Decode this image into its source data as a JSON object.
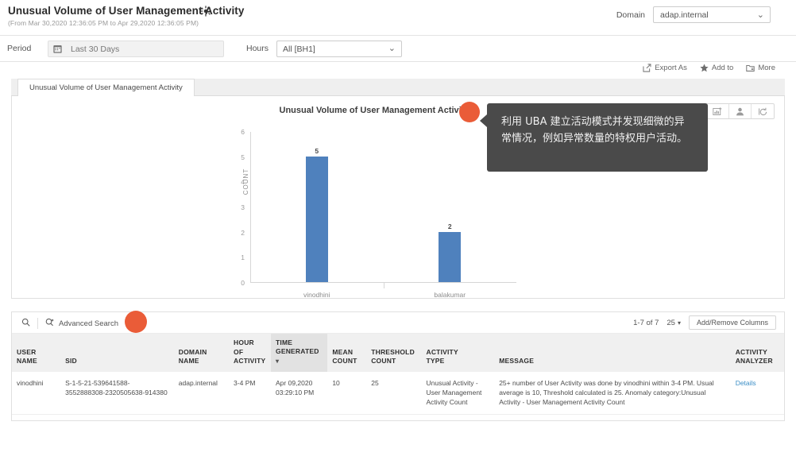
{
  "header": {
    "title": "Unusual Volume of User Management Activity",
    "sparkle_icon": "sparkle-icon",
    "subtitle": "(From Mar 30,2020 12:36:05 PM to Apr 29,2020 12:36:05 PM)",
    "domain_label": "Domain",
    "domain_value": "adap.internal"
  },
  "filters": {
    "period_label": "Period",
    "period_value": "Last 30 Days",
    "calendar_icon": "calendar-icon",
    "hours_label": "Hours",
    "hours_value": "All [BH1]"
  },
  "actions": [
    {
      "label": "Export As",
      "icon": "export-icon"
    },
    {
      "label": "Add to",
      "icon": "star-icon"
    },
    {
      "label": "More",
      "icon": "more-folder-icon"
    }
  ],
  "tab": {
    "label": "Unusual Volume of User Management Activity"
  },
  "chart_tools": [
    {
      "name": "add-chart-icon"
    },
    {
      "name": "user-icon"
    },
    {
      "name": "refresh-icon"
    }
  ],
  "chart_data": {
    "type": "bar",
    "title": "Unusual Volume of User Management Activity",
    "categories": [
      "vinodhini",
      "balakumar"
    ],
    "values": [
      5,
      2
    ],
    "xlabel": "",
    "ylabel": "COUNT",
    "ylim": [
      0,
      6
    ],
    "yticks": [
      0,
      1,
      2,
      3,
      4,
      5,
      6
    ],
    "grid": false,
    "legend": false,
    "bar_color": "#4f81bd",
    "data_labels": [
      "5",
      "2"
    ]
  },
  "callout": {
    "text": "利用 UBA 建立活动模式并发现细微的异常情况，例如异常数量的特权用户活动。",
    "dot_color": "#ea5c38",
    "bg_color": "#4a4a4a"
  },
  "table": {
    "search_icon": "search-icon",
    "advanced_search_icon": "advanced-search-icon",
    "advanced_search_label": "Advanced Search",
    "range_text": "1-7 of 7",
    "page_size": "25",
    "page_size_caret": "▾",
    "add_remove_columns": "Add/Remove Columns",
    "columns": [
      "USER NAME",
      "SID",
      "DOMAIN NAME",
      "HOUR OF ACTIVITY",
      "TIME GENERATED",
      "MEAN COUNT",
      "THRESHOLD COUNT",
      "ACTIVITY TYPE",
      "MESSAGE",
      "ACTIVITY ANALYZER"
    ],
    "sorted_column": "TIME GENERATED",
    "sort_caret": "▾",
    "rows": [
      {
        "user_name": "vinodhini",
        "sid": "S-1-5-21-539641588-3552888308-2320505638-914380",
        "domain_name": "adap.internal",
        "hour_of_activity": "3-4 PM",
        "time_generated": "Apr 09,2020 03:29:10 PM",
        "mean_count": "10",
        "threshold_count": "25",
        "activity_type": "Unusual Activity - User Management Activity Count",
        "message": "25+ number of User Activity was done by vinodhini within 3-4 PM. Usual average is 10, Threshold calculated is 25. Anomaly category:Unusual Activity - User Management Activity Count",
        "activity_analyzer": "Details"
      }
    ]
  }
}
